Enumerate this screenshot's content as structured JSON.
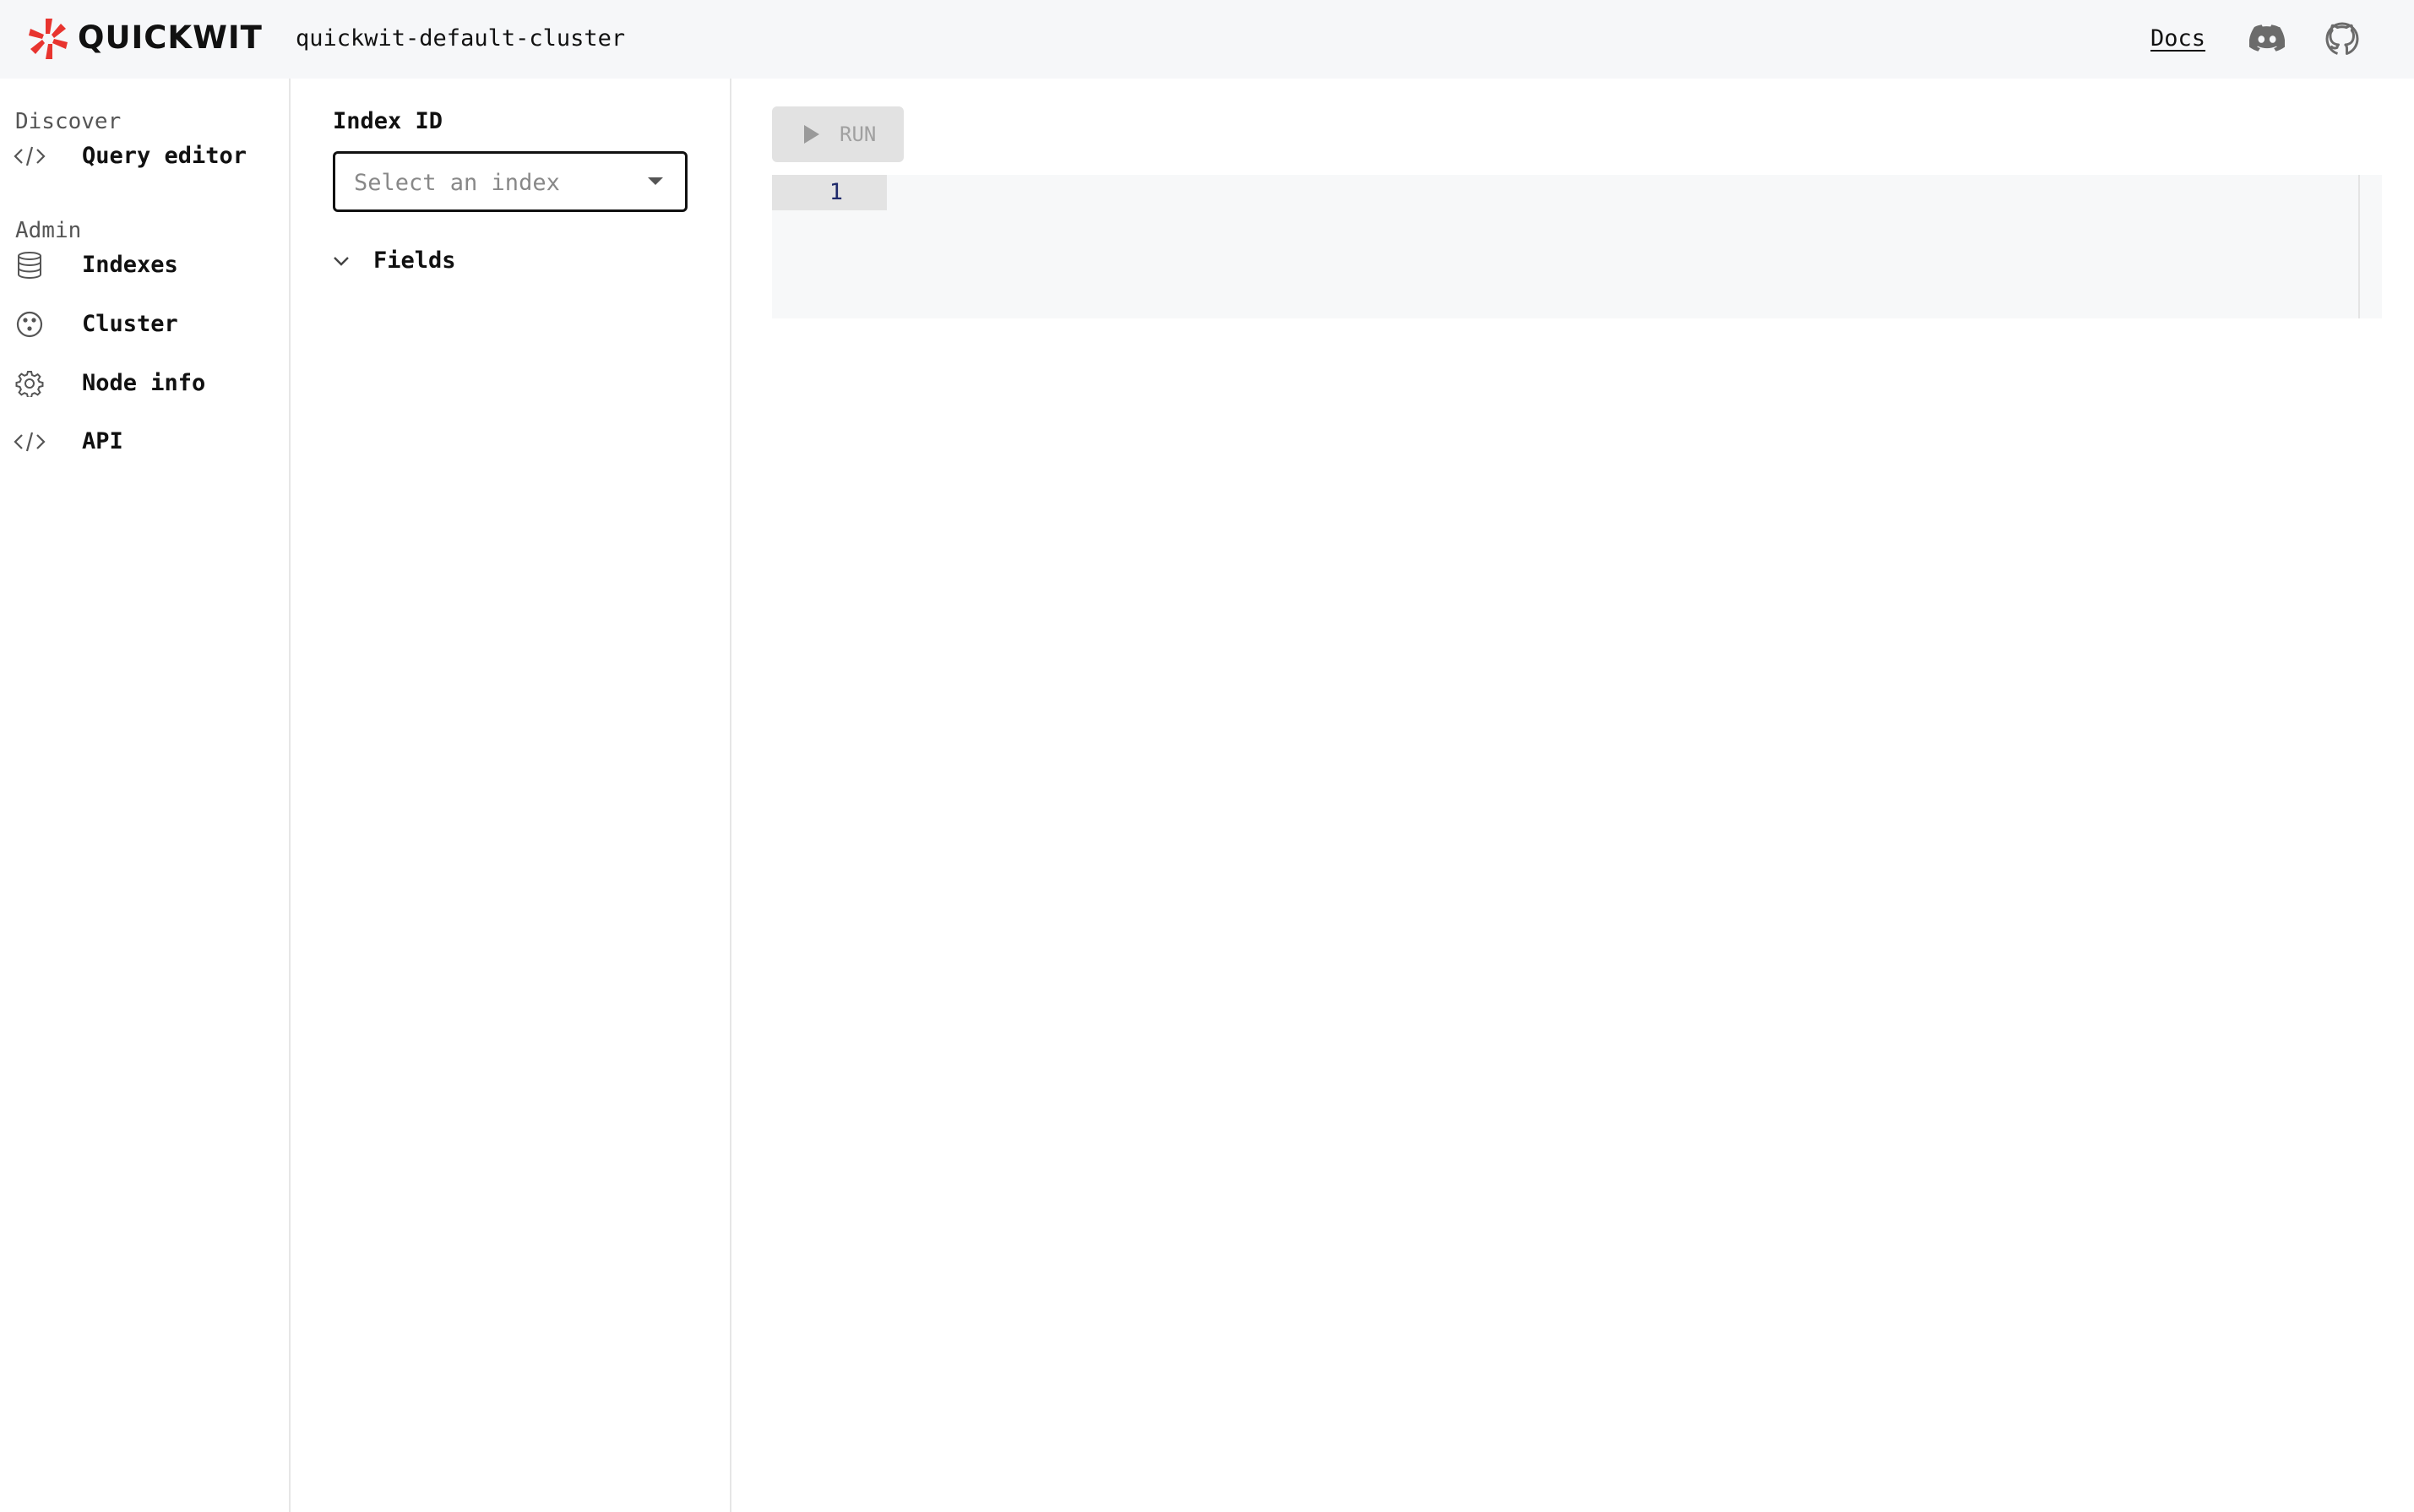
{
  "header": {
    "brand": "QUICKWIT",
    "cluster_name": "quickwit-default-cluster",
    "docs_label": "Docs",
    "logo_color": "#e8342f",
    "icons": [
      "discord-icon",
      "github-icon"
    ]
  },
  "sidebar": {
    "discover_label": "Discover",
    "admin_label": "Admin",
    "items": [
      {
        "label": "Query editor",
        "icon": "code-icon"
      },
      {
        "label": "Indexes",
        "icon": "database-icon"
      },
      {
        "label": "Cluster",
        "icon": "cluster-icon"
      },
      {
        "label": "Node info",
        "icon": "gear-icon"
      },
      {
        "label": "API",
        "icon": "code-icon"
      }
    ]
  },
  "index_panel": {
    "label": "Index ID",
    "select_placeholder": "Select an index",
    "fields_label": "Fields"
  },
  "main": {
    "run_label": "RUN",
    "run_enabled": false,
    "editor": {
      "line_numbers": [
        "1"
      ],
      "content": ""
    }
  }
}
